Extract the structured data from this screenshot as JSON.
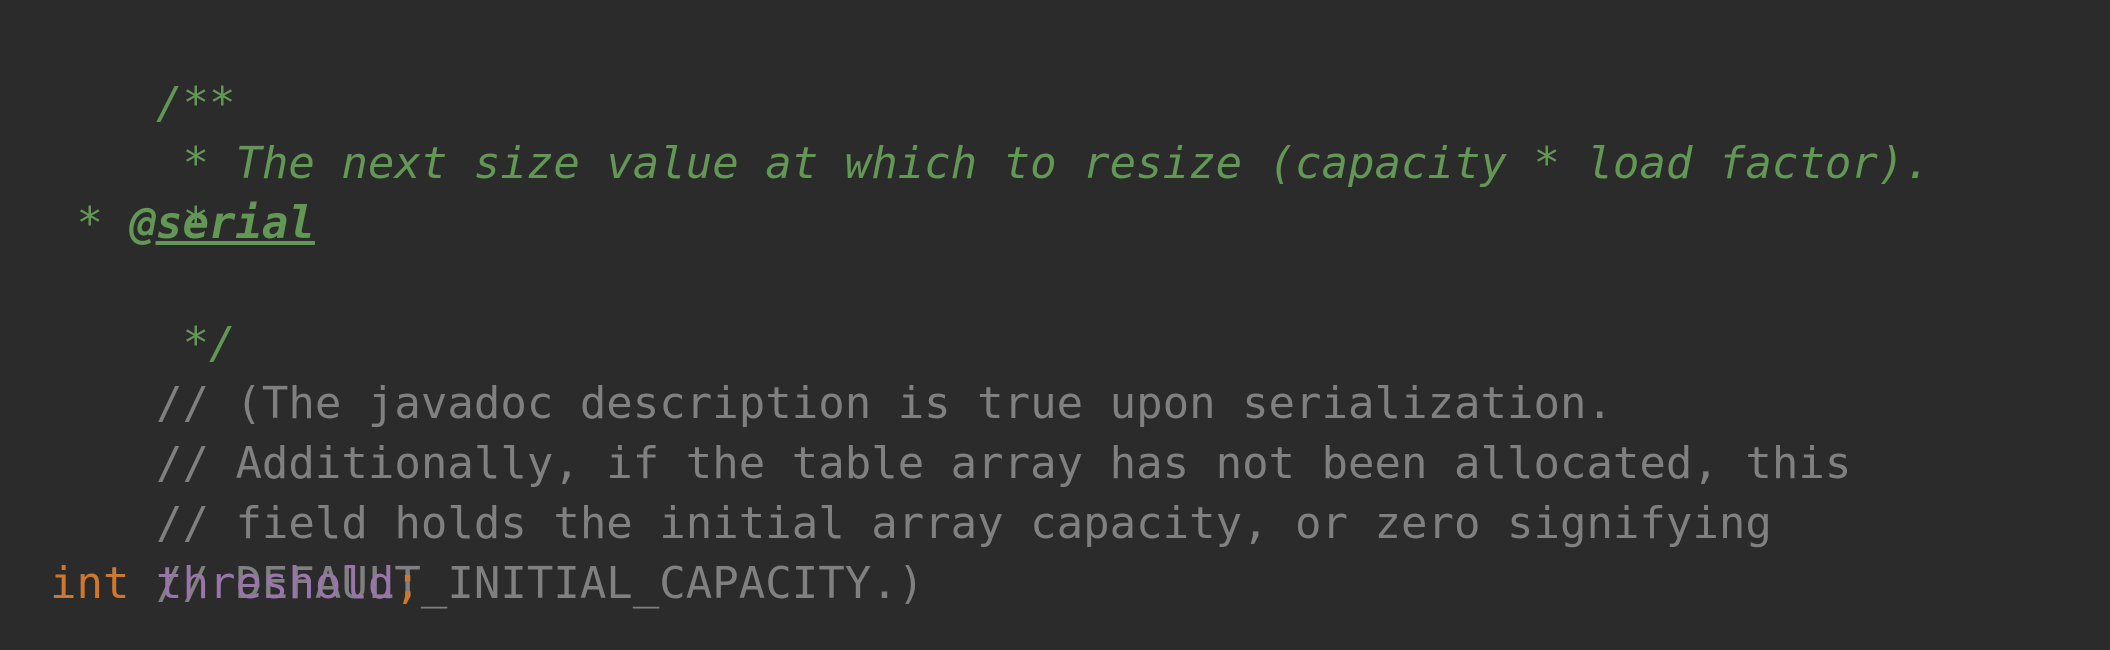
{
  "code": {
    "doc_open": "/**",
    "doc_line1": " * The next size value at which to resize (capacity * load factor).",
    "doc_line2": " *",
    "doc_line3_prefix": " * ",
    "doc_tag": "@serial",
    "doc_close": " */",
    "comment1": "// (The javadoc description is true upon serialization.",
    "comment2": "// Additionally, if the table array has not been allocated, this",
    "comment3": "// field holds the initial array capacity, or zero signifying",
    "comment4": "// DEFAULT_INITIAL_CAPACITY.)",
    "decl_keyword": "int",
    "decl_space": " ",
    "decl_field": "threshold",
    "decl_semicolon": ";"
  },
  "colors": {
    "background": "#2b2b2b",
    "doc_comment": "#629755",
    "line_comment": "#808080",
    "keyword": "#cc7832",
    "field": "#9876aa"
  }
}
